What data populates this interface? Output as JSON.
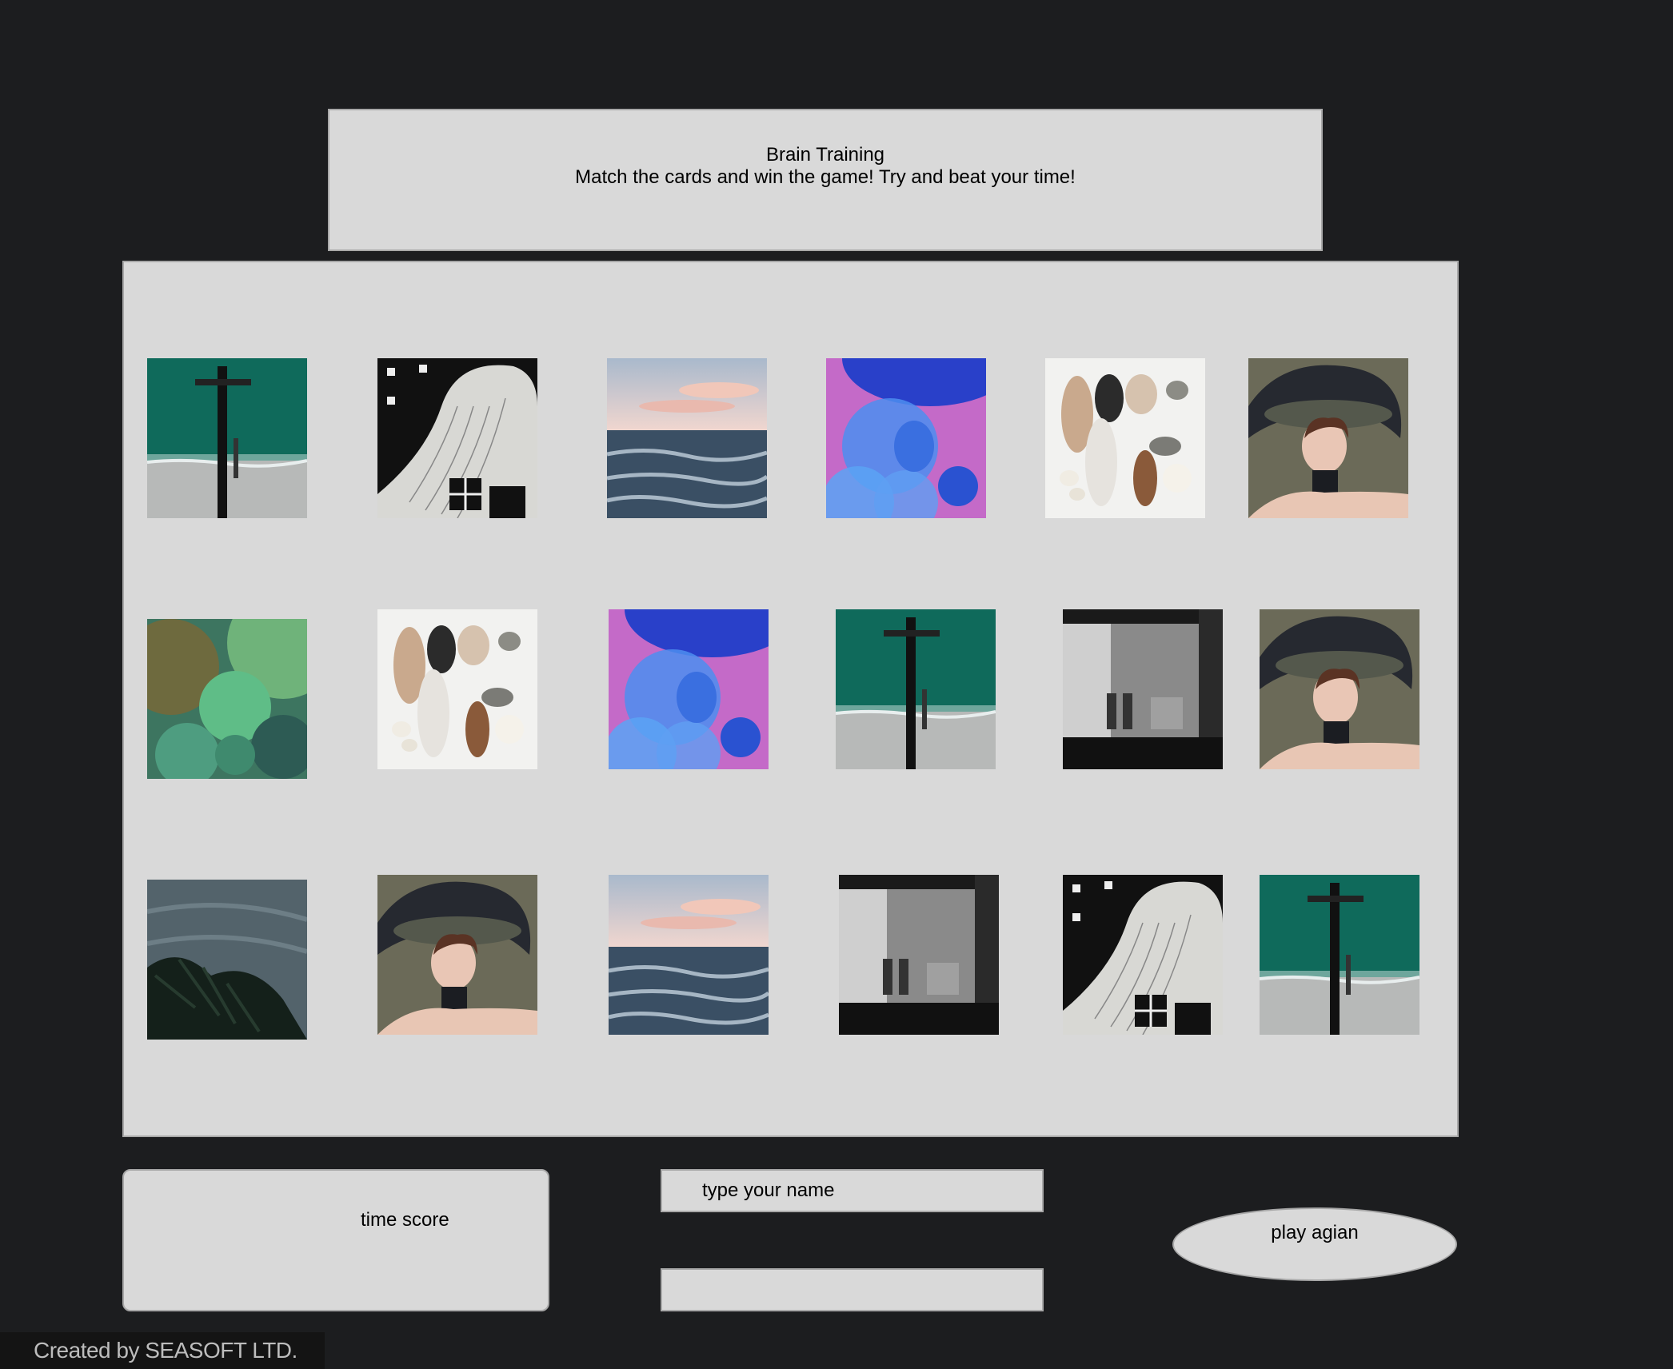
{
  "header": {
    "title": "Brain Training",
    "subtitle": "Match the cards and win the game! Try and beat your time!"
  },
  "board": {
    "cards": [
      {
        "row": 1,
        "col": 1,
        "image": "aerial-beach-pier"
      },
      {
        "row": 1,
        "col": 2,
        "image": "line-art-abstract"
      },
      {
        "row": 1,
        "col": 3,
        "image": "ocean-waves-sunset"
      },
      {
        "row": 1,
        "col": 4,
        "image": "blue-purple-bubbles"
      },
      {
        "row": 1,
        "col": 5,
        "image": "pebble-leaf-collage"
      },
      {
        "row": 1,
        "col": 6,
        "image": "woman-with-hat-illustration"
      },
      {
        "row": 2,
        "col": 1,
        "image": "green-bubbles"
      },
      {
        "row": 2,
        "col": 2,
        "image": "pebble-leaf-collage"
      },
      {
        "row": 2,
        "col": 3,
        "image": "blue-purple-bubbles"
      },
      {
        "row": 2,
        "col": 4,
        "image": "aerial-beach-pier"
      },
      {
        "row": 2,
        "col": 5,
        "image": "black-white-street"
      },
      {
        "row": 2,
        "col": 6,
        "image": "woman-with-hat-illustration"
      },
      {
        "row": 3,
        "col": 1,
        "image": "palm-tree-sea"
      },
      {
        "row": 3,
        "col": 2,
        "image": "woman-with-hat-illustration"
      },
      {
        "row": 3,
        "col": 3,
        "image": "ocean-waves-sunset"
      },
      {
        "row": 3,
        "col": 4,
        "image": "black-white-street"
      },
      {
        "row": 3,
        "col": 5,
        "image": "line-art-abstract"
      },
      {
        "row": 3,
        "col": 6,
        "image": "aerial-beach-pier"
      }
    ]
  },
  "score": {
    "time_label": "time score"
  },
  "name_form": {
    "placeholder": "type your name",
    "second_value": ""
  },
  "play_again": {
    "label": "play agian"
  },
  "footer": {
    "credit": "Created by SEASOFT LTD."
  },
  "colors": {
    "page_background": "#1c1d1f",
    "panel_background": "#d9d9d9",
    "panel_border": "#a8a8a8"
  }
}
